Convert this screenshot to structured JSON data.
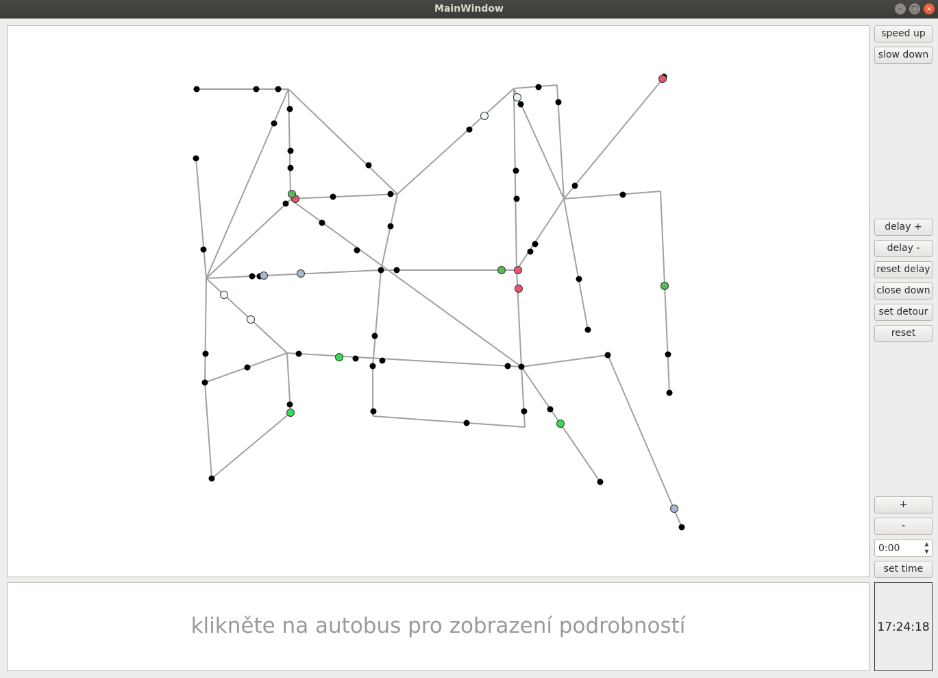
{
  "window": {
    "title": "MainWindow"
  },
  "controls": {
    "speed_up": "speed up",
    "slow_down": "slow down",
    "delay_plus": "delay +",
    "delay_minus": "delay -",
    "reset_delay": "reset delay",
    "close_down": "close down",
    "set_detour": "set detour",
    "reset": "reset",
    "zoom_in": "+",
    "zoom_out": "-",
    "time_value": "0:00",
    "set_time": "set time"
  },
  "info_panel": {
    "hint": "klikněte na autobus pro zobrazení podrobností"
  },
  "clock": {
    "time": "17:24:18"
  },
  "colors": {
    "street": "#a0a0a0",
    "stop": "#000000",
    "bus_red": "#e8556f",
    "bus_green": "#5cb85c",
    "bus_bright_green": "#33dd55",
    "bus_blue_grey": "#aab8cc",
    "bus_white": "#eef8f2"
  }
}
